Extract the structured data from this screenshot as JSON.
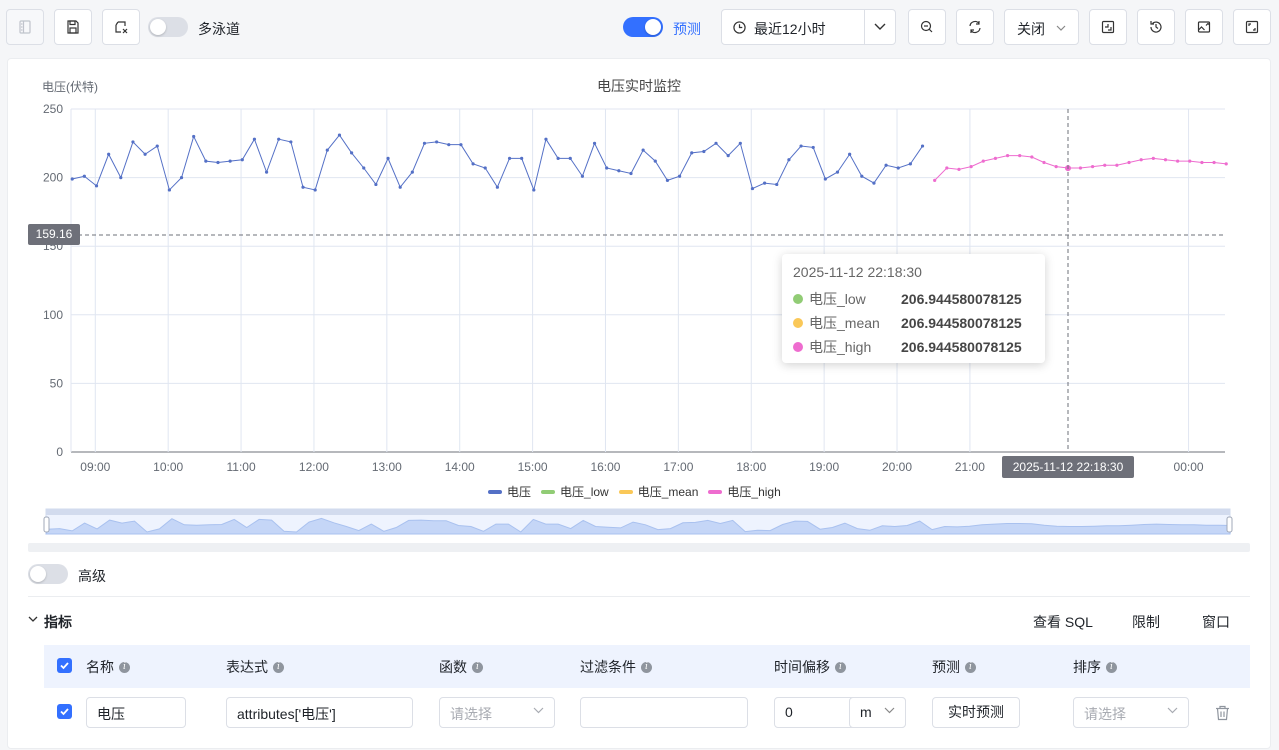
{
  "toolbar": {
    "multi_lane_label": "多泳道",
    "multi_lane_on": false,
    "forecast_label": "预测",
    "forecast_on": true,
    "time_range": "最近12小时",
    "refresh_select": "关闭"
  },
  "chart": {
    "title": "电压实时监控",
    "y_axis_name": "电压(伏特)",
    "y_ticks": [
      "250",
      "200",
      "150",
      "100",
      "50",
      "0"
    ],
    "x_ticks": [
      "09:00",
      "10:00",
      "11:00",
      "12:00",
      "13:00",
      "14:00",
      "15:00",
      "16:00",
      "17:00",
      "18:00",
      "19:00",
      "20:00",
      "21:00",
      "00:00"
    ],
    "y_pointer_label": "159.16",
    "x_pointer_label": "2025-11-12 22:18:30",
    "colors": {
      "voltage": "#5470c6",
      "low": "#91cc75",
      "mean": "#fac858",
      "high": "#ee6ccf"
    }
  },
  "tooltip": {
    "time": "2025-11-12 22:18:30",
    "rows": [
      {
        "name": "电压_low",
        "value": "206.944580078125",
        "color": "#91cc75"
      },
      {
        "name": "电压_mean",
        "value": "206.944580078125",
        "color": "#fac858"
      },
      {
        "name": "电压_high",
        "value": "206.944580078125",
        "color": "#ee6ccf"
      }
    ]
  },
  "legend": [
    {
      "name": "电压",
      "color": "#5470c6"
    },
    {
      "name": "电压_low",
      "color": "#91cc75"
    },
    {
      "name": "电压_mean",
      "color": "#fac858"
    },
    {
      "name": "电压_high",
      "color": "#ee6ccf"
    }
  ],
  "chart_data": {
    "type": "line",
    "title": "电压实时监控",
    "ylabel": "电压(伏特)",
    "ylim": [
      0,
      250
    ],
    "x_range": [
      "08:40",
      "00:30"
    ],
    "grid": true,
    "legend_position": "bottom",
    "series": [
      {
        "name": "电压",
        "x_start": "08:41",
        "interval_minutes": 10,
        "values": [
          199,
          201,
          194,
          217,
          200,
          226,
          217,
          223,
          191,
          200,
          230,
          212,
          211,
          212,
          213,
          228,
          204,
          228,
          226,
          193,
          191,
          220,
          231,
          218,
          207,
          195,
          214,
          193,
          204,
          225,
          226,
          224,
          224,
          210,
          207,
          193,
          214,
          214,
          191,
          228,
          214,
          214,
          201,
          225,
          207,
          205,
          203,
          220,
          212,
          198,
          201,
          218,
          219,
          225,
          216,
          225,
          192,
          196,
          195,
          213,
          223,
          222,
          199,
          204,
          217,
          201,
          196,
          209,
          207,
          210,
          223
        ]
      },
      {
        "name": "电压_high",
        "x_start": "20:31",
        "interval_minutes": 10,
        "values": [
          198,
          207,
          206,
          208,
          212,
          214,
          216,
          216,
          215,
          211,
          208,
          207,
          207,
          208,
          209,
          209,
          211,
          213,
          214,
          213,
          212,
          212,
          211,
          211,
          210
        ]
      }
    ]
  },
  "advanced": {
    "label": "高级",
    "on": false
  },
  "metrics": {
    "title": "指标",
    "actions": [
      "查看 SQL",
      "限制",
      "窗口"
    ],
    "columns": [
      "名称",
      "表达式",
      "函数",
      "过滤条件",
      "时间偏移",
      "预测",
      "排序"
    ],
    "row": {
      "name": "电压",
      "expression": "attributes['电压']",
      "function_placeholder": "请选择",
      "filter": "",
      "offset": "0",
      "offset_unit": "m",
      "forecast_button": "实时预测",
      "sort_placeholder": "请选择"
    }
  }
}
